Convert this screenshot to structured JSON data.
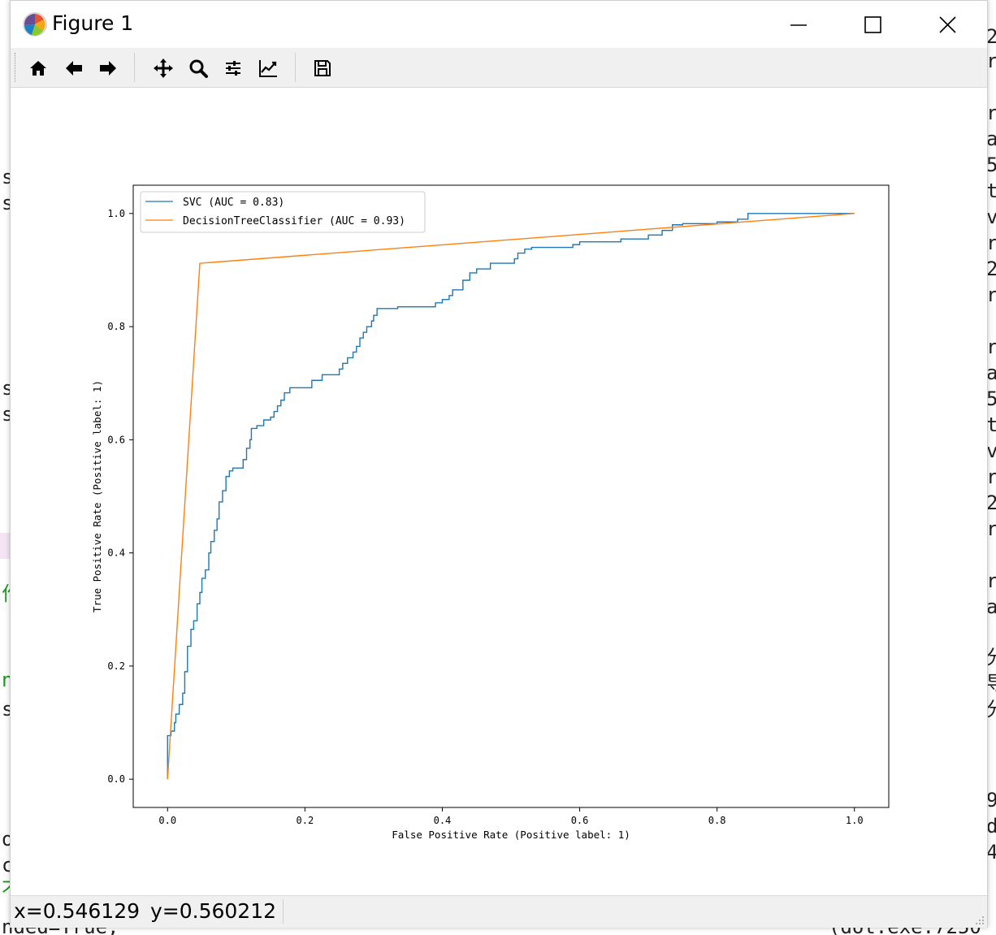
{
  "window": {
    "title": "Figure 1"
  },
  "toolbar": {
    "buttons": [
      "home-icon",
      "back-arrow-icon",
      "forward-arrow-icon",
      "pan-icon",
      "zoom-icon",
      "configure-subplots-icon",
      "edit-axis-icon",
      "save-icon"
    ]
  },
  "status": {
    "x_readout": "x=0.546129",
    "y_readout": "y=0.560212"
  },
  "background_editor": {
    "left_fragments": [
      "s",
      "s",
      "s",
      "s",
      "作",
      "n",
      "s",
      "o",
      "c",
      "不"
    ],
    "right_fragments": [
      "2",
      "r",
      "r",
      "a",
      "58",
      "ta",
      "ve",
      "ro",
      "2",
      "r",
      "r",
      "a",
      "58",
      "ta",
      "ve",
      "ro",
      "2",
      "r",
      "r",
      "a",
      "分",
      "导",
      "分",
      "98",
      "de",
      "4"
    ],
    "bottom_left": "nded=True,",
    "bottom_right": "(dot.exe:7250"
  },
  "colors": {
    "svc_line": "#1f77b4",
    "tree_line": "#ff7f0e",
    "window_bg": "#ffffff",
    "toolbar_bg": "#f0f0f0"
  },
  "chart_data": {
    "type": "line",
    "title": "",
    "xlabel": "False Positive Rate (Positive label: 1)",
    "ylabel": "True Positive Rate (Positive label: 1)",
    "xlim": [
      -0.05,
      1.05
    ],
    "ylim": [
      -0.05,
      1.05
    ],
    "xticks": [
      0.0,
      0.2,
      0.4,
      0.6,
      0.8,
      1.0
    ],
    "xtick_labels": [
      "0.0",
      "0.2",
      "0.4",
      "0.6",
      "0.8",
      "1.0"
    ],
    "yticks": [
      0.0,
      0.2,
      0.4,
      0.6,
      0.8,
      1.0
    ],
    "ytick_labels": [
      "0.0",
      "0.2",
      "0.4",
      "0.6",
      "0.8",
      "1.0"
    ],
    "grid": false,
    "legend_position": "upper-left",
    "series": [
      {
        "name": "SVC (AUC = 0.83)",
        "color": "#1f77b4",
        "points": [
          [
            0.0,
            0.0
          ],
          [
            0.0,
            0.077
          ],
          [
            0.005,
            0.077
          ],
          [
            0.005,
            0.085
          ],
          [
            0.01,
            0.085
          ],
          [
            0.01,
            0.1
          ],
          [
            0.012,
            0.1
          ],
          [
            0.012,
            0.115
          ],
          [
            0.017,
            0.115
          ],
          [
            0.017,
            0.132
          ],
          [
            0.022,
            0.132
          ],
          [
            0.022,
            0.152
          ],
          [
            0.025,
            0.152
          ],
          [
            0.025,
            0.19
          ],
          [
            0.029,
            0.19
          ],
          [
            0.029,
            0.235
          ],
          [
            0.034,
            0.235
          ],
          [
            0.034,
            0.265
          ],
          [
            0.038,
            0.265
          ],
          [
            0.038,
            0.28
          ],
          [
            0.043,
            0.28
          ],
          [
            0.043,
            0.31
          ],
          [
            0.047,
            0.31
          ],
          [
            0.047,
            0.33
          ],
          [
            0.05,
            0.33
          ],
          [
            0.05,
            0.355
          ],
          [
            0.055,
            0.355
          ],
          [
            0.055,
            0.37
          ],
          [
            0.06,
            0.37
          ],
          [
            0.06,
            0.4
          ],
          [
            0.063,
            0.4
          ],
          [
            0.063,
            0.42
          ],
          [
            0.068,
            0.42
          ],
          [
            0.068,
            0.44
          ],
          [
            0.072,
            0.44
          ],
          [
            0.072,
            0.46
          ],
          [
            0.075,
            0.46
          ],
          [
            0.075,
            0.49
          ],
          [
            0.08,
            0.49
          ],
          [
            0.08,
            0.51
          ],
          [
            0.085,
            0.51
          ],
          [
            0.085,
            0.535
          ],
          [
            0.09,
            0.535
          ],
          [
            0.09,
            0.545
          ],
          [
            0.095,
            0.545
          ],
          [
            0.095,
            0.55
          ],
          [
            0.11,
            0.55
          ],
          [
            0.11,
            0.565
          ],
          [
            0.115,
            0.565
          ],
          [
            0.115,
            0.585
          ],
          [
            0.12,
            0.585
          ],
          [
            0.12,
            0.6
          ],
          [
            0.122,
            0.6
          ],
          [
            0.122,
            0.62
          ],
          [
            0.13,
            0.62
          ],
          [
            0.13,
            0.625
          ],
          [
            0.14,
            0.625
          ],
          [
            0.14,
            0.635
          ],
          [
            0.15,
            0.635
          ],
          [
            0.15,
            0.64
          ],
          [
            0.155,
            0.64
          ],
          [
            0.155,
            0.65
          ],
          [
            0.16,
            0.65
          ],
          [
            0.16,
            0.66
          ],
          [
            0.165,
            0.66
          ],
          [
            0.165,
            0.67
          ],
          [
            0.17,
            0.67
          ],
          [
            0.17,
            0.683
          ],
          [
            0.178,
            0.683
          ],
          [
            0.178,
            0.692
          ],
          [
            0.21,
            0.692
          ],
          [
            0.21,
            0.705
          ],
          [
            0.225,
            0.705
          ],
          [
            0.225,
            0.715
          ],
          [
            0.25,
            0.715
          ],
          [
            0.25,
            0.725
          ],
          [
            0.255,
            0.725
          ],
          [
            0.255,
            0.735
          ],
          [
            0.262,
            0.735
          ],
          [
            0.262,
            0.745
          ],
          [
            0.27,
            0.745
          ],
          [
            0.27,
            0.755
          ],
          [
            0.275,
            0.755
          ],
          [
            0.275,
            0.765
          ],
          [
            0.28,
            0.765
          ],
          [
            0.28,
            0.78
          ],
          [
            0.285,
            0.78
          ],
          [
            0.285,
            0.79
          ],
          [
            0.29,
            0.79
          ],
          [
            0.29,
            0.8
          ],
          [
            0.297,
            0.8
          ],
          [
            0.297,
            0.81
          ],
          [
            0.3,
            0.81
          ],
          [
            0.3,
            0.82
          ],
          [
            0.305,
            0.82
          ],
          [
            0.305,
            0.832
          ],
          [
            0.335,
            0.832
          ],
          [
            0.335,
            0.835
          ],
          [
            0.39,
            0.835
          ],
          [
            0.39,
            0.842
          ],
          [
            0.4,
            0.842
          ],
          [
            0.4,
            0.848
          ],
          [
            0.41,
            0.848
          ],
          [
            0.41,
            0.855
          ],
          [
            0.415,
            0.855
          ],
          [
            0.415,
            0.865
          ],
          [
            0.43,
            0.865
          ],
          [
            0.43,
            0.882
          ],
          [
            0.44,
            0.882
          ],
          [
            0.44,
            0.895
          ],
          [
            0.45,
            0.895
          ],
          [
            0.45,
            0.902
          ],
          [
            0.47,
            0.902
          ],
          [
            0.47,
            0.912
          ],
          [
            0.505,
            0.912
          ],
          [
            0.505,
            0.92
          ],
          [
            0.51,
            0.92
          ],
          [
            0.51,
            0.93
          ],
          [
            0.52,
            0.93
          ],
          [
            0.52,
            0.937
          ],
          [
            0.53,
            0.937
          ],
          [
            0.53,
            0.94
          ],
          [
            0.59,
            0.94
          ],
          [
            0.59,
            0.945
          ],
          [
            0.6,
            0.945
          ],
          [
            0.6,
            0.95
          ],
          [
            0.66,
            0.95
          ],
          [
            0.66,
            0.955
          ],
          [
            0.7,
            0.955
          ],
          [
            0.7,
            0.962
          ],
          [
            0.72,
            0.962
          ],
          [
            0.72,
            0.97
          ],
          [
            0.735,
            0.97
          ],
          [
            0.735,
            0.98
          ],
          [
            0.75,
            0.98
          ],
          [
            0.75,
            0.982
          ],
          [
            0.8,
            0.982
          ],
          [
            0.8,
            0.985
          ],
          [
            0.83,
            0.985
          ],
          [
            0.83,
            0.99
          ],
          [
            0.845,
            0.99
          ],
          [
            0.845,
            1.0
          ],
          [
            1.0,
            1.0
          ]
        ]
      },
      {
        "name": "DecisionTreeClassifier (AUC = 0.93)",
        "color": "#ff7f0e",
        "points": [
          [
            0.0,
            0.0
          ],
          [
            0.047,
            0.912
          ],
          [
            1.0,
            1.0
          ]
        ]
      }
    ]
  }
}
